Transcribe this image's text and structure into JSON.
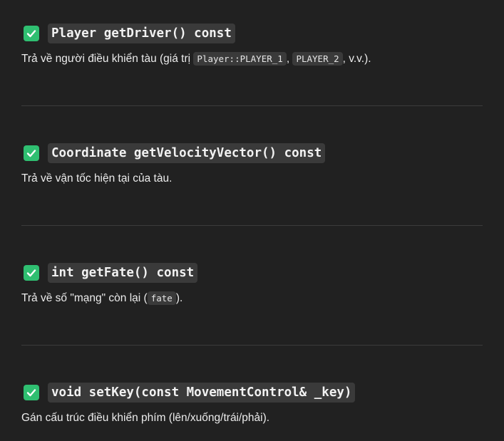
{
  "sections": [
    {
      "signature": "Player getDriver() const",
      "desc_parts": [
        "Trả về người điều khiển tàu (giá trị ",
        "Player::PLAYER_1",
        ", ",
        "PLAYER_2",
        ", v.v.)."
      ]
    },
    {
      "signature": "Coordinate getVelocityVector() const",
      "desc_parts": [
        "Trả về vận tốc hiện tại của tàu."
      ]
    },
    {
      "signature": "int getFate() const",
      "desc_parts": [
        "Trả về số \"mạng\" còn lại (",
        "fate",
        ")."
      ]
    },
    {
      "signature": "void setKey(const MovementControl& _key)",
      "desc_parts": [
        "Gán cấu trúc điều khiển phím (lên/xuống/trái/phải)."
      ]
    }
  ],
  "colors": {
    "background": "#212121",
    "check": "#2fbf71",
    "code_bg": "#3a3a3a"
  },
  "icons": {
    "check": "check-mark-icon"
  }
}
